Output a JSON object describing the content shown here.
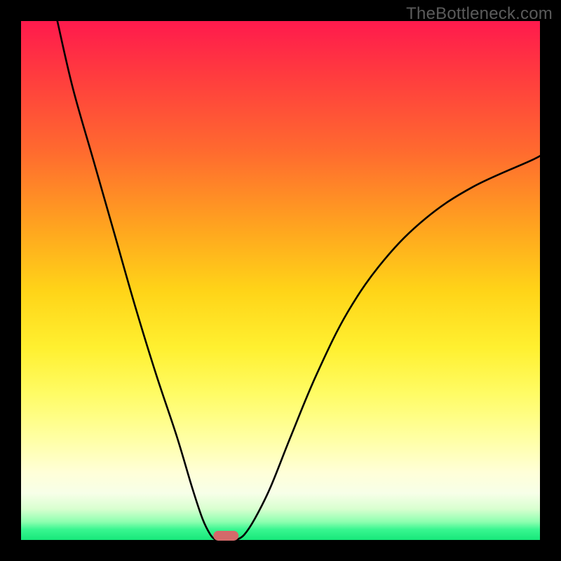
{
  "watermark": "TheBottleneck.com",
  "chart_data": {
    "type": "line",
    "title": "",
    "xlabel": "",
    "ylabel": "",
    "xlim": [
      0,
      100
    ],
    "ylim": [
      0,
      100
    ],
    "grid": false,
    "legend": false,
    "colors": {
      "curve": "#000000",
      "marker": "#d46a6a",
      "gradient_top": "#ff1a4d",
      "gradient_bottom": "#17e87a"
    },
    "series": [
      {
        "name": "left-branch",
        "x": [
          7,
          10,
          14,
          18,
          22,
          26,
          30,
          33,
          35,
          36.5,
          37.5
        ],
        "y": [
          100,
          87,
          73,
          59,
          45,
          32,
          20,
          10,
          4,
          1,
          0
        ]
      },
      {
        "name": "right-branch",
        "x": [
          41.5,
          43,
          45,
          48,
          52,
          57,
          63,
          70,
          78,
          87,
          98,
          100
        ],
        "y": [
          0,
          1,
          4,
          10,
          20,
          32,
          44,
          54,
          62,
          68,
          73,
          74
        ]
      }
    ],
    "marker": {
      "x": 39.5,
      "y": 0.8,
      "width_pct": 4.8,
      "height_pct": 1.9
    }
  }
}
